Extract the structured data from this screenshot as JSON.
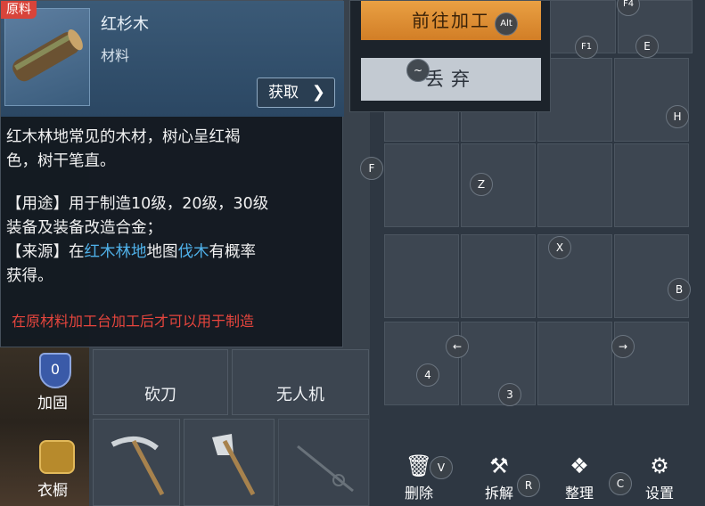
{
  "item": {
    "tag": "原料",
    "name": "红杉木",
    "type": "材料",
    "get_button": "获取",
    "desc_line1": "红木林地常见的木材，树心呈红褐",
    "desc_line2": "色，树干笔直。",
    "use_line1": "【用途】用于制造10级，20级，30级",
    "use_line2": "装备及装备改造合金；",
    "source_prefix": "【来源】在",
    "source_place": "红木林地",
    "source_mid": "地图",
    "source_action": "伐木",
    "source_suffix": "有概率",
    "source_line2": "获得。",
    "warning": "在原材料加工台加工后才可以用于制造"
  },
  "popup": {
    "go_button": "前往加工",
    "go_key": "Alt",
    "drop_button": "丢弃",
    "drop_key": "~"
  },
  "keys": {
    "f4": "F4",
    "f1": "F1",
    "e": "E",
    "h": "H",
    "f": "F",
    "z": "Z",
    "x": "X",
    "b": "B",
    "left": "←",
    "right": "→",
    "four": "4",
    "three": "3",
    "v": "V",
    "r": "R",
    "c": "C"
  },
  "tiles": {
    "machete": "砍刀",
    "drone": "无人机"
  },
  "side": {
    "reinforce_level": "0",
    "reinforce": "加固",
    "wardrobe_icon": "衣",
    "wardrobe": "衣橱"
  },
  "toolbar": {
    "delete": "删除",
    "dismantle": "拆解",
    "organize": "整理",
    "settings": "设置"
  },
  "colors": {
    "accent_orange": "#e09538",
    "warning_red": "#e6453d",
    "link_blue": "#4fb0e8",
    "tag_red": "#d8443a"
  }
}
